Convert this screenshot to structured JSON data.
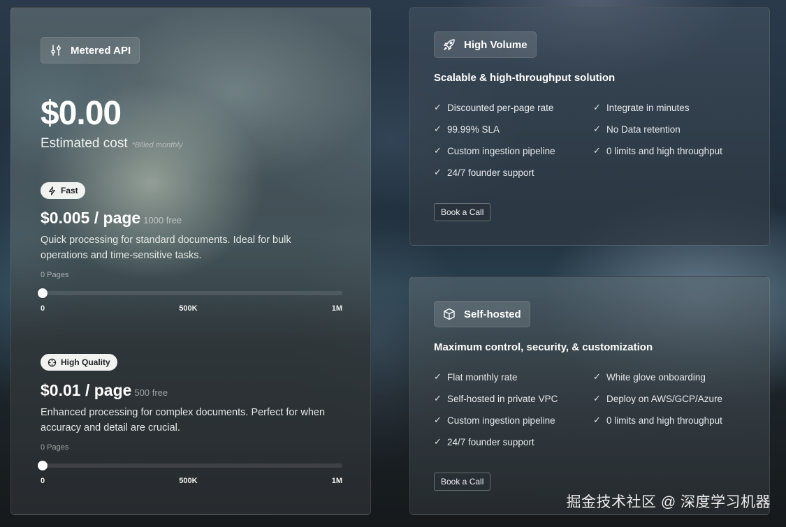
{
  "metered": {
    "tag_label": "Metered API",
    "tag_icon": "sliders-icon",
    "price": "$0.00",
    "estimated_label": "Estimated cost",
    "billed_note": "*Billed monthly",
    "tiers": [
      {
        "pill_label": "Fast",
        "pill_icon": "lightning-icon",
        "price": "$0.005 / page",
        "free_note": "1000 free",
        "description": "Quick processing for standard documents. Ideal for bulk operations and time-sensitive tasks.",
        "pages_label": "0 Pages",
        "slider_value": 0,
        "ticks": [
          "0",
          "500K",
          "1M"
        ]
      },
      {
        "pill_label": "High Quality",
        "pill_icon": "crosshair-icon",
        "price": "$0.01 / page",
        "free_note": "500 free",
        "description": "Enhanced processing for complex documents. Perfect for when accuracy and detail are crucial.",
        "pages_label": "0 Pages",
        "slider_value": 0,
        "ticks": [
          "0",
          "500K",
          "1M"
        ]
      }
    ]
  },
  "high_volume": {
    "tag_label": "High Volume",
    "tag_icon": "rocket-icon",
    "subtitle": "Scalable & high-throughput solution",
    "features": [
      "Discounted per-page rate",
      "Integrate in minutes",
      "99.99% SLA",
      "No Data retention",
      "Custom ingestion pipeline",
      "0 limits and high throughput",
      "24/7 founder support"
    ],
    "button": "Book a Call"
  },
  "self_hosted": {
    "tag_label": "Self-hosted",
    "tag_icon": "cube-icon",
    "subtitle": "Maximum control, security, & customization",
    "features": [
      "Flat monthly rate",
      "White glove onboarding",
      "Self-hosted in private VPC",
      "Deploy on AWS/GCP/Azure",
      "Custom ingestion pipeline",
      "0 limits and high throughput",
      "24/7 founder support"
    ],
    "button": "Book a Call"
  },
  "watermark": "掘金技术社区 @ 深度学习机器"
}
